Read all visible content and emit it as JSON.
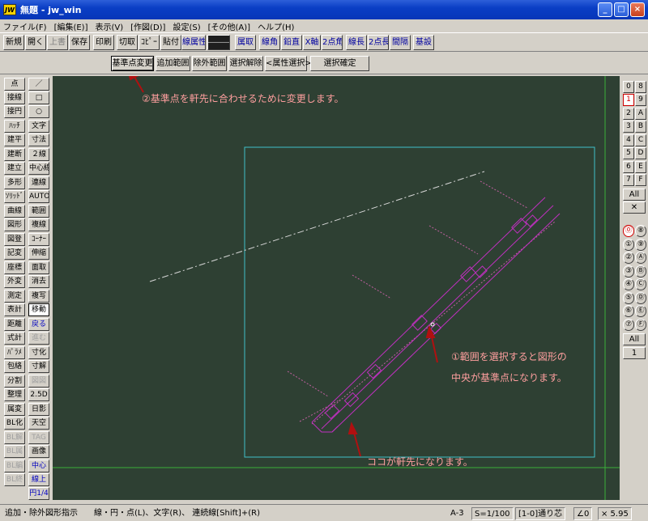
{
  "window": {
    "title": "無題 - jw_win",
    "icon": "JW"
  },
  "window_controls": [
    "_",
    "□",
    "×"
  ],
  "menu": [
    "ファイル(F)",
    "[編集(E)]",
    "表示(V)",
    "[作図(D)]",
    "設定(S)",
    "[その他(A)]",
    "ヘルプ(H)"
  ],
  "toolbar": {
    "items": [
      "新規",
      "開く",
      "上書",
      "保存",
      "印刷",
      "切取",
      "ｺﾋﾟｰ",
      "貼付",
      "線属性",
      "――――",
      "属取",
      "線角",
      "鉛直",
      "X軸",
      "2点角",
      "線長",
      "2点長",
      "間隔",
      "基設"
    ]
  },
  "subbar": {
    "items": [
      "基準点変更",
      "追加範囲",
      "除外範囲",
      "選択解除",
      "<属性選択>",
      "選択確定"
    ]
  },
  "left_tools": {
    "col1": [
      "点",
      "接線",
      "接円",
      "ﾊｯﾁ",
      "建平",
      "建断",
      "建立",
      "多形",
      "ｿﾘｯﾄﾞ",
      "曲線",
      "図形",
      "図登",
      "記変",
      "座標",
      "外変",
      "測定",
      "表計",
      "距離",
      "式計",
      "ﾊﾟﾗﾒ",
      "包絡",
      "分割",
      "整理",
      "属変",
      "BL化",
      "BL解",
      "BL属",
      "BL編",
      "BL終"
    ],
    "col2": [
      "／",
      "□",
      "○",
      "文字",
      "寸法",
      "２線",
      "中心線",
      "連線",
      "AUTO",
      "範囲",
      "複線",
      "ｺｰﾅｰ",
      "伸縮",
      "面取",
      "消去",
      "複写",
      "移動",
      "戻る",
      "進む",
      "寸化",
      "寸解",
      "図図",
      "2.5D",
      "日影",
      "天空",
      "TAG",
      "画像",
      "中心",
      "線上",
      "円1/4"
    ]
  },
  "right_panel": {
    "layer_groups": [
      [
        "0",
        "8"
      ],
      [
        "1",
        "9"
      ],
      [
        "2",
        "A"
      ],
      [
        "3",
        "B"
      ],
      [
        "4",
        "C"
      ],
      [
        "5",
        "D"
      ],
      [
        "6",
        "E"
      ],
      [
        "7",
        "F"
      ]
    ],
    "all_label": "All",
    "x_label": "✕",
    "layers": [
      [
        "⓪",
        "⑧"
      ],
      [
        "①",
        "⑨"
      ],
      [
        "②",
        "Ⓐ"
      ],
      [
        "③",
        "Ⓑ"
      ],
      [
        "④",
        "Ⓒ"
      ],
      [
        "⑤",
        "Ⓓ"
      ],
      [
        "⑥",
        "Ⓔ"
      ],
      [
        "⑦",
        "Ⓕ"
      ]
    ],
    "all2_label": "All",
    "one_label": "1"
  },
  "annotations": {
    "a2": "②基準点を軒先に合わせるために変更します。",
    "a1_line1": "①範囲を選択すると図形の",
    "a1_line2": "中央が基準点になります。",
    "a3": "ココが軒先になります。"
  },
  "status": {
    "message": "追加・除外図形指示　　線・円・点(L)、文字(R)、 連続線[Shift]+(R)",
    "paper": "A-3",
    "scale": "S=1/100",
    "layer": "[1-0]通り芯",
    "angle": "∠0",
    "zoom": "× 5.95"
  },
  "colors": {
    "canvas_bg": "#2e4033",
    "magenta": "#c030c0",
    "cyan": "#40c0c8",
    "green": "#3ab03a",
    "annotation": "#ff9f9f",
    "arrow": "#b01010"
  }
}
